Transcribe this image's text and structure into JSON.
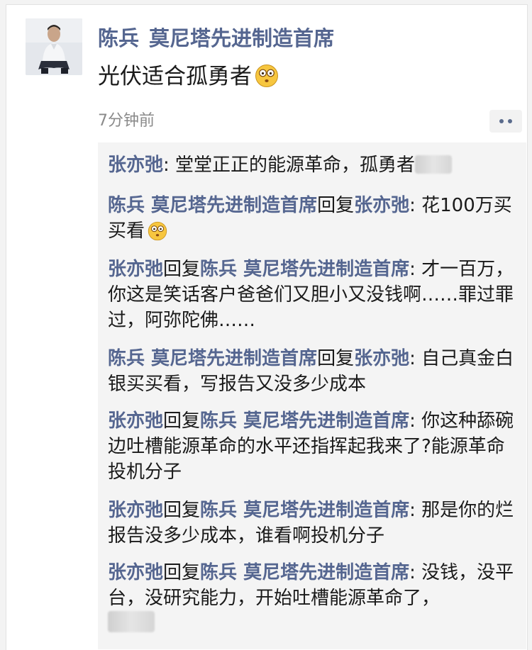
{
  "post": {
    "author_name": "陈兵",
    "author_title": "莫尼塔先进制造首席",
    "text": "光伏适合孤勇者",
    "emoji": "astonished-face-emoji",
    "timestamp": "7分钟前",
    "more_icon": "ellipsis-icon"
  },
  "comments": [
    {
      "from": "张亦弛",
      "sep": ": ",
      "text": "堂堂正正的能源革命，孤勇者"
    },
    {
      "from": "陈兵 莫尼塔先进制造首席",
      "reply": "回复",
      "to": "张亦弛",
      "sep": ": ",
      "text": "花100万买买看"
    },
    {
      "from": "张亦弛",
      "reply": "回复",
      "to": "陈兵 莫尼塔先进制造首席",
      "sep": ": ",
      "text": "才一百万，你这是笑话客户爸爸们又胆小又没钱啊……罪过罪过，阿弥陀佛……"
    },
    {
      "from": "陈兵 莫尼塔先进制造首席",
      "reply": "回复",
      "to": "张亦弛",
      "sep": ": ",
      "text": "自己真金白银买买看，写报告又没多少成本"
    },
    {
      "from": "张亦弛",
      "reply": "回复",
      "to": "陈兵 莫尼塔先进制造首席",
      "sep": ": ",
      "text": "你这种舔碗边吐槽能源革命的水平还指挥起我来了?能源革命投机分子"
    },
    {
      "from": "张亦弛",
      "reply": "回复",
      "to": "陈兵 莫尼塔先进制造首席",
      "sep": ": ",
      "text": "那是你的烂报告没多少成本，谁看啊投机分子"
    },
    {
      "from": "张亦弛",
      "reply": "回复",
      "to": "陈兵 莫尼塔先进制造首席",
      "sep": ": ",
      "text": "没钱，没平台，没研究能力，开始吐槽能源革命了，"
    }
  ]
}
